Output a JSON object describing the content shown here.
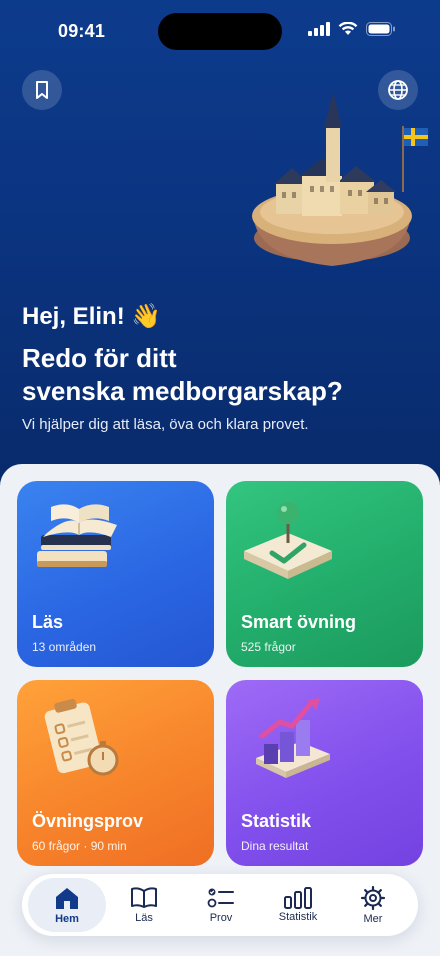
{
  "status_bar": {
    "time": "09:41"
  },
  "hero": {
    "greeting": "Hej, Elin! 👋",
    "headline_line1": "Redo för ditt",
    "headline_line2": "svenska medborgarskap?",
    "subtext": "Vi hjälper dig att läsa, öva och klara provet."
  },
  "cards": [
    {
      "title": "Läs",
      "subtitle": "13 områden",
      "icon": "book-stack-icon",
      "color": "#2b67e3"
    },
    {
      "title": "Smart övning",
      "subtitle": "525 frågor",
      "icon": "pin-check-icon",
      "color": "#22ad6b"
    },
    {
      "title": "Övningsprov",
      "subtitle": "60 frågor · 90 min",
      "icon": "clipboard-stopwatch-icon",
      "color": "#f7842b"
    },
    {
      "title": "Statistik",
      "subtitle": "Dina resultat",
      "icon": "bar-chart-icon",
      "color": "#8250ec"
    }
  ],
  "tabs": [
    {
      "label": "Hem",
      "icon": "home-icon",
      "active": true
    },
    {
      "label": "Läs",
      "icon": "book-icon",
      "active": false
    },
    {
      "label": "Prov",
      "icon": "checklist-icon",
      "active": false
    },
    {
      "label": "Statistik",
      "icon": "chart-icon",
      "active": false
    },
    {
      "label": "Mer",
      "icon": "gear-icon",
      "active": false
    }
  ],
  "colors": {
    "hero_bg": "#0b3480",
    "active_tab": "#123a8a",
    "flag_blue": "#1f5fb8",
    "flag_yellow": "#f6c416"
  }
}
